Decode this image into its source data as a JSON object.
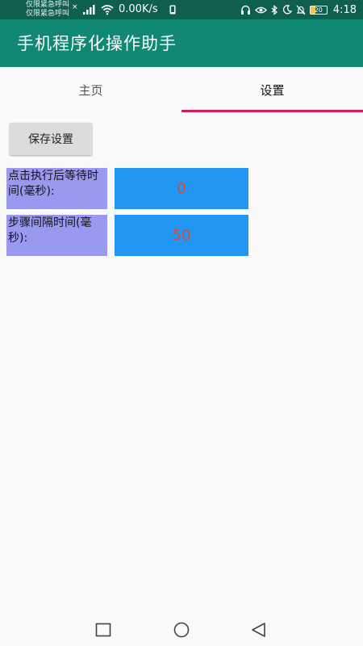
{
  "status_bar": {
    "carrier_line1": "仅限紧急呼叫",
    "carrier_line2": "仅限紧急呼叫",
    "no_signal_mark": "×",
    "network_speed": "0.00K/s",
    "battery_level": "20",
    "time": "4:18"
  },
  "app": {
    "title": "手机程序化操作助手"
  },
  "tabs": [
    {
      "label": "主页",
      "selected": false
    },
    {
      "label": "设置",
      "selected": true
    }
  ],
  "settings": {
    "save_button_label": "保存设置",
    "click_wait": {
      "label": "点击执行后等待时间(毫秒):",
      "value": "0"
    },
    "step_interval": {
      "label": "步骤间隔时间(毫秒):",
      "value": "50"
    }
  },
  "colors": {
    "status_bar": "#0f5f4f",
    "app_bar": "#118874",
    "tab_indicator": "#d81b60",
    "label_background": "#9999f0",
    "input_background": "#2196f3",
    "input_text": "#d84a3a"
  },
  "nav_bar": {
    "icons": [
      "recent-apps-icon",
      "home-icon",
      "back-icon"
    ]
  }
}
